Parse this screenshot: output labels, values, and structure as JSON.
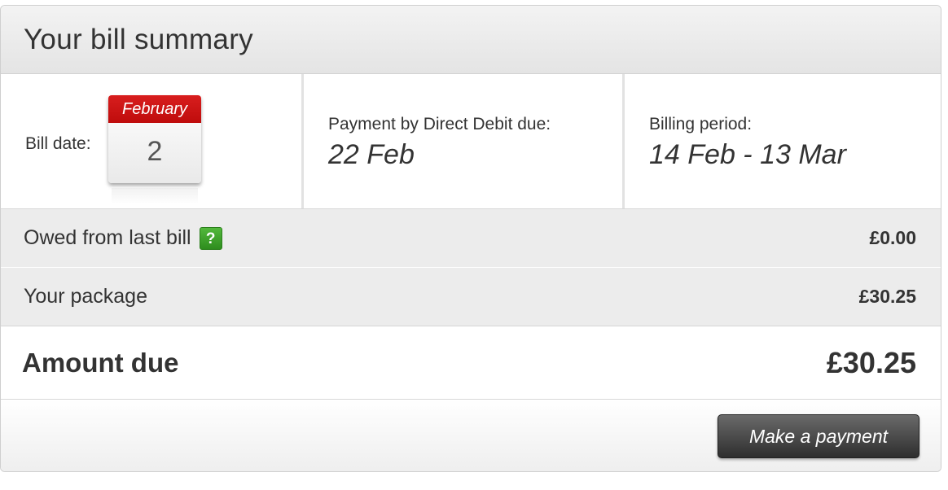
{
  "header": {
    "title": "Your bill summary"
  },
  "bill_date": {
    "label": "Bill date:",
    "calendar_month": "February",
    "calendar_day": "2"
  },
  "payment_due": {
    "label": "Payment by Direct Debit due:",
    "value": "22 Feb"
  },
  "billing_period": {
    "label": "Billing period:",
    "value": "14 Feb - 13 Mar"
  },
  "lines": [
    {
      "label": "Owed from last bill",
      "value": "£0.00",
      "help_icon": "question-mark"
    },
    {
      "label": "Your package",
      "value": "£30.25"
    }
  ],
  "total": {
    "label": "Amount due",
    "value": "£30.25"
  },
  "actions": {
    "make_payment_label": "Make a payment"
  },
  "colors": {
    "calendar_red": "#c8102e",
    "help_green": "#3ea52b",
    "button_dark": "#3a3a3a"
  }
}
